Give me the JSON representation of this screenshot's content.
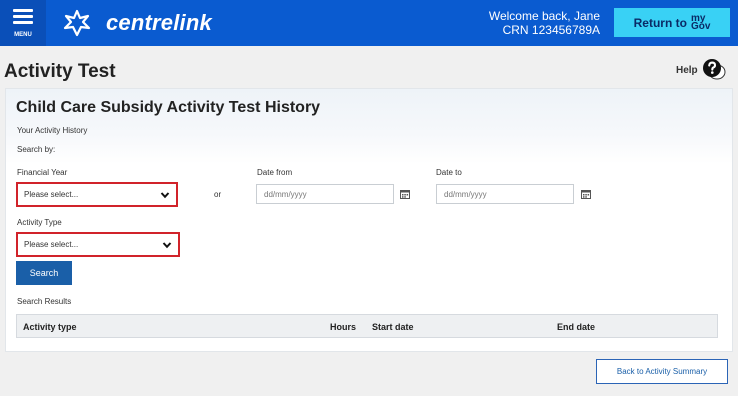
{
  "header": {
    "menu_label": "MENU",
    "brand": "centrelink",
    "welcome_line1": "Welcome back, Jane",
    "welcome_line2": "CRN 123456789A",
    "return_label": "Return to",
    "mygov_line1": "my",
    "mygov_line2": "Gov"
  },
  "page": {
    "title": "Activity Test",
    "help_label": "Help"
  },
  "card": {
    "title": "Child Care Subsidy Activity Test History",
    "subtitle": "Your Activity History",
    "search_by": "Search by:",
    "financial_year_label": "Financial Year",
    "financial_year_value": "Please select...",
    "or_text": "or",
    "date_from_label": "Date from",
    "date_from_placeholder": "dd/mm/yyyy",
    "date_to_label": "Date to",
    "date_to_placeholder": "dd/mm/yyyy",
    "activity_type_label": "Activity Type",
    "activity_type_value": "Please select...",
    "search_button": "Search",
    "results_label": "Search Results",
    "columns": [
      "Activity type",
      "Hours",
      "Start date",
      "End date"
    ]
  },
  "footer": {
    "back_label": "Back to Activity Summary"
  },
  "colors": {
    "header_blue": "#0a5bd0",
    "accent_cyan": "#39d1f5",
    "error_red": "#d1232a",
    "button_blue": "#1a5fa8"
  }
}
